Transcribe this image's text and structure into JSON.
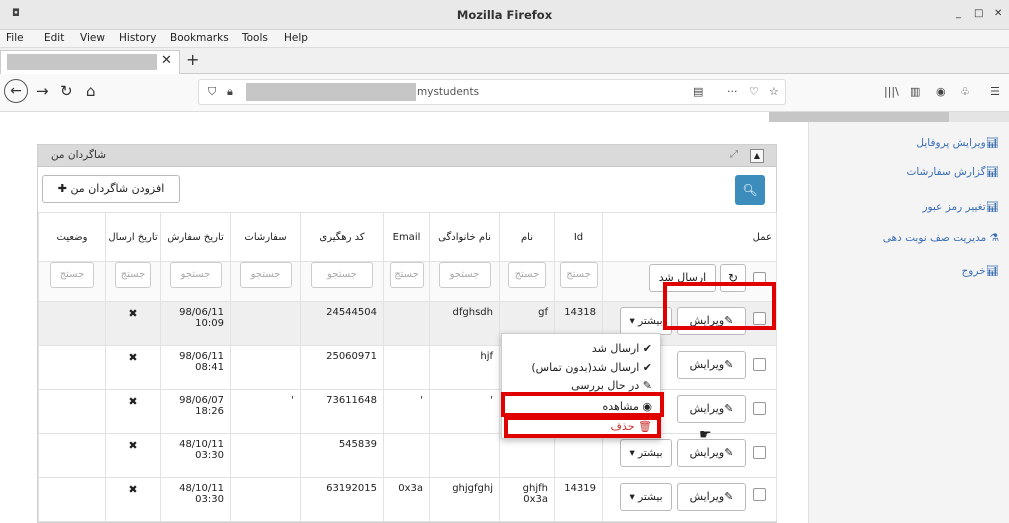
{
  "browser": {
    "window_title": "Mozilla Firefox",
    "menu": [
      "File",
      "Edit",
      "View",
      "History",
      "Bookmarks",
      "Tools",
      "Help"
    ],
    "url_text": "mystudents",
    "zoom_more": "···"
  },
  "sidebar": {
    "items": [
      {
        "label": "ویرایش پروفایل"
      },
      {
        "label": "گزارش سفارشات"
      },
      {
        "label": "تغییر رمز عبور"
      },
      {
        "label": "مدیریت صف نوبت دهی"
      },
      {
        "label": "خروج"
      }
    ]
  },
  "panel": {
    "title": "شاگردان من",
    "add_button": "افزودن شاگردان من",
    "columns": [
      "وضعیت",
      "تاریخ ارسال",
      "تاریخ سفارش",
      "سفارشات",
      "کد رهگیری",
      "Email",
      "نام خانوادگی",
      "نام",
      "Id",
      "عمل"
    ],
    "filters": [
      "جستج",
      "جستج",
      "جستجو",
      "جستجو",
      "جستجو",
      "جستج",
      "جستجو",
      "جستج",
      "جستج"
    ],
    "sent_button": "ارسال شد",
    "edit_label": "ویرایش",
    "more_label": "بیشتر"
  },
  "rows": [
    {
      "status": "",
      "sent": "✖",
      "order_date": "98/06/11",
      "order_time": "10:09",
      "orders": "",
      "tracking": "24544504",
      "email": "",
      "last_name": "dfghsdh",
      "first_name": "gf",
      "first_name2": "",
      "id": "14318"
    },
    {
      "status": "",
      "sent": "✖",
      "order_date": "98/06/11",
      "order_time": "08:41",
      "orders": "",
      "tracking": "25060971",
      "email": "",
      "last_name": "hjf",
      "first_name": "",
      "first_name2": "",
      "id": ""
    },
    {
      "status": "",
      "sent": "✖",
      "order_date": "98/06/07",
      "order_time": "18:26",
      "orders": "'",
      "tracking": "73611648",
      "email": "'",
      "last_name": "'",
      "first_name": "",
      "first_name2": "",
      "id": ""
    },
    {
      "status": "",
      "sent": "✖",
      "order_date": "48/10/11",
      "order_time": "03:30",
      "orders": "",
      "tracking": "545839",
      "email": "",
      "last_name": "",
      "first_name": "",
      "first_name2": "",
      "id": ""
    },
    {
      "status": "",
      "sent": "✖",
      "order_date": "48/10/11",
      "order_time": "03:30",
      "orders": "",
      "tracking": "63192015",
      "email": "0x3a",
      "last_name": "ghjgfghj",
      "first_name": "ghjfh",
      "first_name2": "0x3a",
      "id": "14319"
    }
  ],
  "dropdown": {
    "items": [
      {
        "label": "ارسال شد",
        "icon": "check-icon"
      },
      {
        "label": "ارسال شد(بدون تماس)",
        "icon": "check-icon"
      },
      {
        "label": "در حال بررسی",
        "icon": "edit-icon"
      },
      {
        "label": "مشاهده",
        "icon": "eye-icon"
      },
      {
        "label": "حذف",
        "icon": "trash-icon"
      }
    ]
  },
  "colors": {
    "accent": "#3c8dbc",
    "highlight": "#e00000",
    "link": "#3b6fb5",
    "danger": "#c9302c"
  }
}
